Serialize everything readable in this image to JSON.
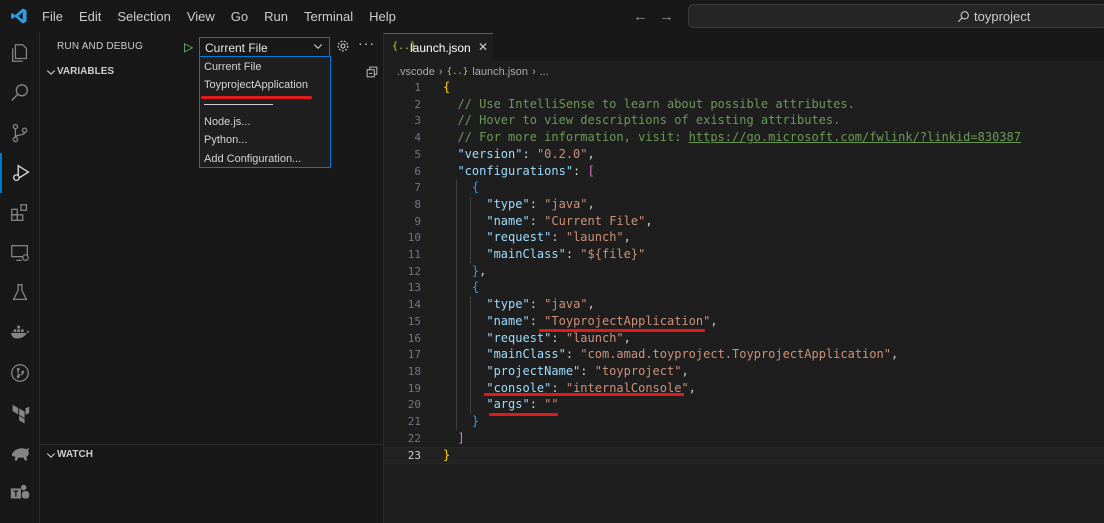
{
  "menu": [
    "File",
    "Edit",
    "Selection",
    "View",
    "Go",
    "Run",
    "Terminal",
    "Help"
  ],
  "search": {
    "text": "toyproject"
  },
  "sidebar": {
    "header": "RUN AND DEBUG",
    "config_value": "Current File",
    "variables_label": "VARIABLES",
    "watch_label": "WATCH"
  },
  "dropdown": {
    "items": [
      "Current File",
      "ToyprojectApplication",
      "Node.js...",
      "Python...",
      "Add Configuration..."
    ]
  },
  "tab": {
    "label": "launch.json",
    "icon": "{..}"
  },
  "breadcrumb": [
    ".vscode",
    "launch.json",
    "..."
  ],
  "code": {
    "line_numbers": [
      "1",
      "2",
      "3",
      "4",
      "5",
      "6",
      "7",
      "8",
      "9",
      "10",
      "11",
      "12",
      "13",
      "14",
      "15",
      "16",
      "17",
      "18",
      "19",
      "20",
      "21",
      "22",
      "23"
    ],
    "comment1": "// Use IntelliSense to learn about possible attributes.",
    "comment2": "// Hover to view descriptions of existing attributes.",
    "comment3_prefix": "// For more information, visit: ",
    "comment3_url": "https://go.microsoft.com/fwlink/?linkid=830387",
    "version_key": "\"version\"",
    "version_val": "\"0.2.0\"",
    "configurations_key": "\"configurations\"",
    "type_key": "\"type\"",
    "name_key": "\"name\"",
    "request_key": "\"request\"",
    "mainClass_key": "\"mainClass\"",
    "projectName_key": "\"projectName\"",
    "console_key": "\"console\"",
    "args_key": "\"args\"",
    "java": "\"java\"",
    "current_file": "\"Current File\"",
    "launch": "\"launch\"",
    "file_var": "\"${file}\"",
    "toy_app": "\"ToyprojectApplication\"",
    "main_class_full": "\"com.amad.toyproject.ToyprojectApplication\"",
    "toyproject": "\"toyproject\"",
    "internal_console": "\"internalConsole\"",
    "empty_str": "\"\""
  },
  "colors": {
    "accent": "#0078d4",
    "annotation": "#e01b1b"
  }
}
